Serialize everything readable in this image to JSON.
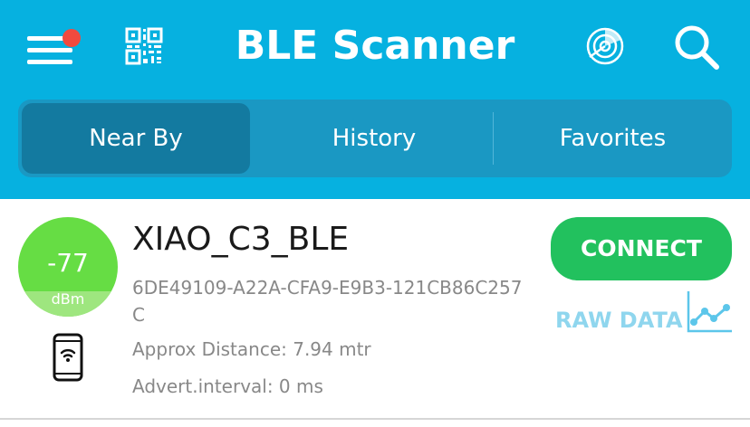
{
  "header": {
    "title": "BLE Scanner",
    "background_color": "#06b1e0",
    "notification_dot_color": "#f14a3e",
    "icons": [
      "menu-icon",
      "qr-code-icon",
      "radar-icon",
      "search-icon"
    ]
  },
  "tabs": [
    {
      "label": "Near By",
      "active": true
    },
    {
      "label": "History",
      "active": false
    },
    {
      "label": "Favorites",
      "active": false
    }
  ],
  "device": {
    "rssi": "-77",
    "rssi_unit": "dBm",
    "name": "XIAO_C3_BLE",
    "uuid": "6DE49109-A22A-CFA9-E9B3-121CB86C257C",
    "distance": "Approx Distance: 7.94 mtr",
    "advert_interval": "Advert.interval: 0 ms",
    "connect_label": "CONNECT",
    "raw_data_label": "RAW DATA",
    "connect_color": "#22c15e",
    "rssi_color": "#66dd44"
  }
}
